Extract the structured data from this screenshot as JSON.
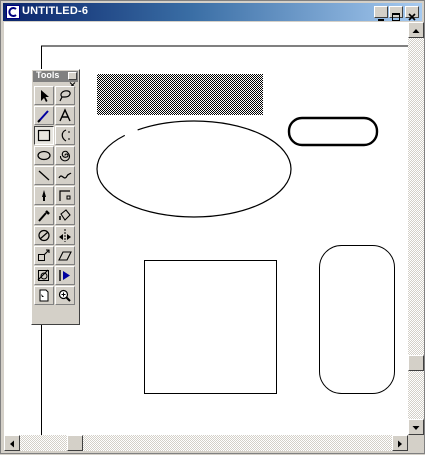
{
  "window": {
    "title": "UNTITLED-6",
    "controls": [
      "minimize",
      "maximize",
      "close"
    ]
  },
  "tools_panel": {
    "title": "Tools",
    "selected_tool": "rectangle-tool",
    "tools": [
      "pointer-tool",
      "lasso-tool",
      "pen-tool",
      "text-tool",
      "rectangle-tool",
      "arc-tool",
      "ellipse-tool",
      "spiral-tool",
      "line-tool",
      "freehand-tool",
      "knife-tool",
      "corner-tool",
      "eyedropper-tool",
      "fill-tool",
      "rotate-tool",
      "reflect-tool",
      "scale-tool",
      "skew-tool",
      "trace-tool",
      "blend-tool",
      "page-tool",
      "zoom-tool"
    ]
  },
  "colors": {
    "title_gradient_start": "#0a246a",
    "title_gradient_end": "#a6caf0",
    "chrome": "#d4d0c8",
    "canvas": "#ffffff",
    "ink": "#000000"
  }
}
